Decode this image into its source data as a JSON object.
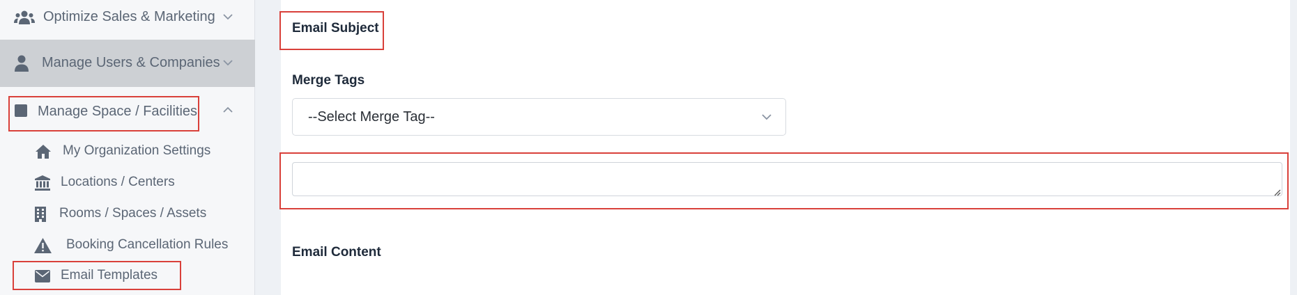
{
  "sidebar": {
    "items": [
      {
        "label": "Optimize Sales & Marketing",
        "icon": "users-group-icon",
        "expanded": false
      },
      {
        "label": "Manage Users & Companies",
        "icon": "user-icon",
        "expanded": false,
        "active": true
      },
      {
        "label": "Manage Space / Facilities",
        "icon": "square-icon",
        "expanded": true
      }
    ],
    "sub_items": [
      {
        "label": "My Organization Settings",
        "icon": "home-icon"
      },
      {
        "label": "Locations / Centers",
        "icon": "bank-icon"
      },
      {
        "label": "Rooms / Spaces / Assets",
        "icon": "building-icon"
      },
      {
        "label": "Booking Cancellation Rules",
        "icon": "warning-icon"
      },
      {
        "label": "Email Templates",
        "icon": "envelope-icon"
      }
    ]
  },
  "main": {
    "email_subject_label": "Email Subject",
    "merge_tags_label": "Merge Tags",
    "merge_tag_select": {
      "selected": "--Select Merge Tag--"
    },
    "subject_text": {
      "value": ""
    },
    "email_content_label": "Email Content"
  },
  "colors": {
    "highlight": "#d9403a",
    "active_item_bg": "#cdd0d4",
    "sidebar_bg": "#f6f7f9",
    "text_muted": "#5b6675",
    "heading": "#1e2a3a"
  }
}
